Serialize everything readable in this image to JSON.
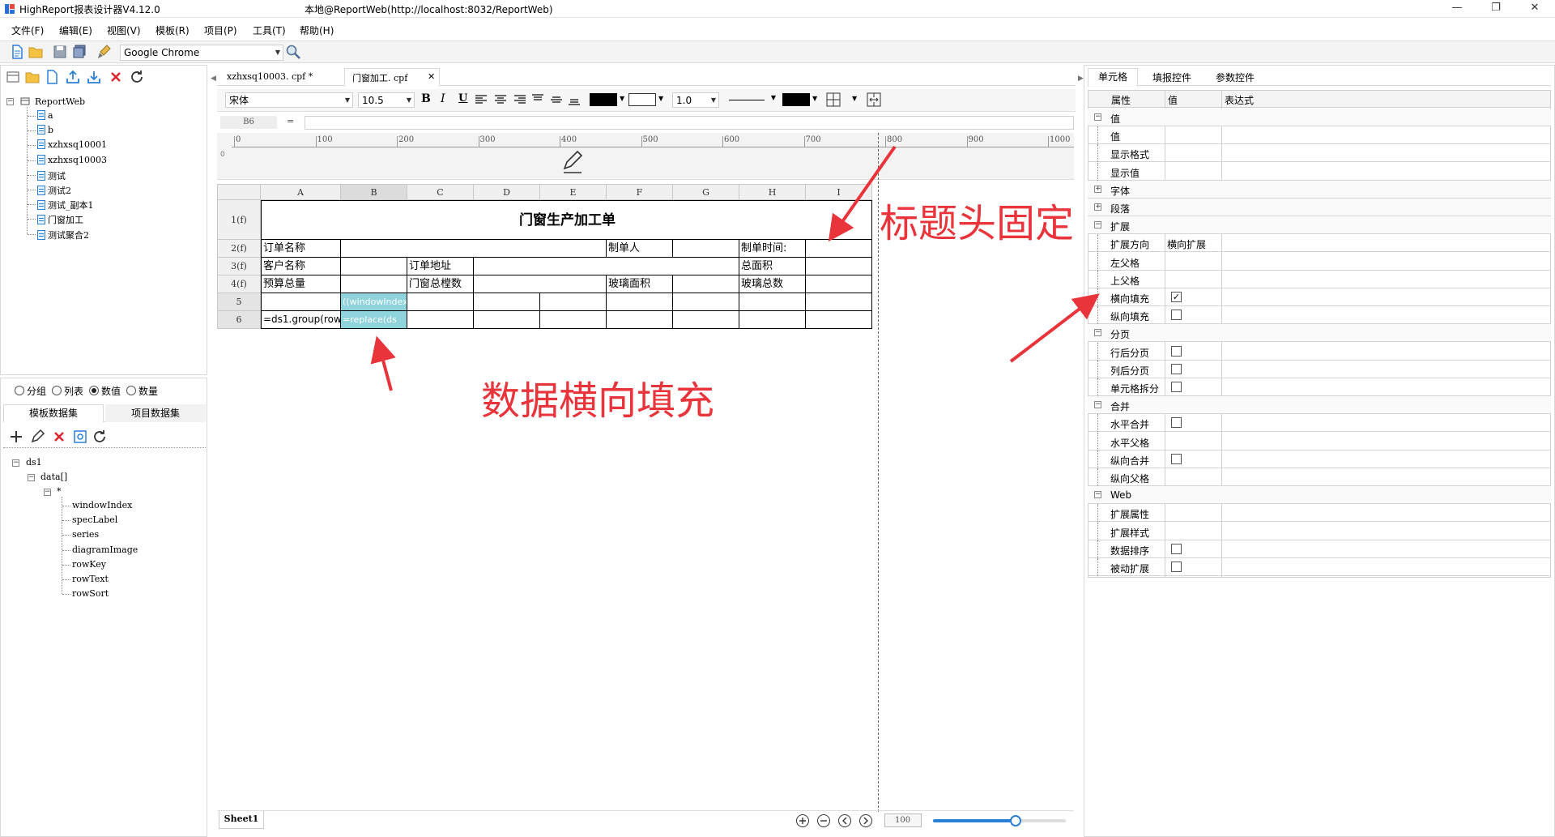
{
  "window": {
    "app_title": "HighReport报表设计器V4.12.0",
    "context_title": "本地@ReportWeb(http://localhost:8032/ReportWeb)",
    "minimize": "—",
    "maximize": "❐",
    "close": "✕"
  },
  "menu": [
    "文件(F)",
    "编辑(E)",
    "视图(V)",
    "模板(R)",
    "项目(P)",
    "工具(T)",
    "帮助(H)"
  ],
  "toolbar": {
    "browser": "Google Chrome"
  },
  "tree": {
    "root": "ReportWeb",
    "items": [
      "a",
      "b",
      "xzhxsq10001",
      "xzhxsq10003",
      "测试",
      "测试2",
      "测试_副本1",
      "门窗加工",
      "测试聚合2"
    ]
  },
  "dataset_panel": {
    "radios": [
      {
        "label": "分组",
        "checked": false
      },
      {
        "label": "列表",
        "checked": false
      },
      {
        "label": "数值",
        "checked": true
      },
      {
        "label": "数量",
        "checked": false
      }
    ],
    "tabs": [
      "模板数据集",
      "项目数据集"
    ],
    "root": "ds1",
    "node": "data[]",
    "star": "*",
    "fields": [
      "windowIndex",
      "specLabel",
      "series",
      "diagramImage",
      "rowKey",
      "rowText",
      "rowSort"
    ]
  },
  "editor_tabs": [
    {
      "label": "xzhxsq10003. cpf *",
      "active": false
    },
    {
      "label": "门窗加工. cpf",
      "active": true,
      "close": "✕"
    }
  ],
  "format": {
    "font": "宋体",
    "size": "10.5",
    "bold": "B",
    "italic": "I",
    "underline": "U",
    "line_width": "1.0",
    "cell_ref": "B6",
    "eq": "="
  },
  "ruler": [
    "0",
    "100",
    "200",
    "300",
    "400",
    "500",
    "600",
    "700",
    "800",
    "900",
    "1000"
  ],
  "columns": [
    "A",
    "B",
    "C",
    "D",
    "E",
    "F",
    "G",
    "H",
    "I"
  ],
  "rows": [
    "1(f)",
    "2(f)",
    "3(f)",
    "4(f)",
    "5",
    "6"
  ],
  "sheet": {
    "title": "门窗生产加工单",
    "r2": {
      "a": "订单名称",
      "f": "制单人",
      "h": "制单时间:"
    },
    "r3": {
      "a": "客户名称",
      "c": "订单地址",
      "h": "总面积"
    },
    "r4": {
      "a": "预算总量",
      "c": "门窗总樘数",
      "f": "玻璃面积",
      "h": "玻璃总数"
    },
    "b5": "((windowIndex",
    "a6": "=ds1.group(row",
    "b6": "=replace(ds"
  },
  "bottom": {
    "sheet_tab": "Sheet1",
    "zoom": "100",
    "zoom_level": 0.62
  },
  "right_tabs": [
    "单元格",
    "填报控件",
    "参数控件"
  ],
  "prop_header": [
    "属性",
    "值",
    "表达式"
  ],
  "props": [
    {
      "type": "group",
      "label": "值",
      "expanded": true
    },
    {
      "type": "item",
      "label": "值"
    },
    {
      "type": "item",
      "label": "显示格式"
    },
    {
      "type": "item",
      "label": "显示值"
    },
    {
      "type": "group",
      "label": "字体",
      "expanded": false
    },
    {
      "type": "group",
      "label": "段落",
      "expanded": false
    },
    {
      "type": "group",
      "label": "扩展",
      "expanded": true
    },
    {
      "type": "item",
      "label": "扩展方向",
      "value": "横向扩展"
    },
    {
      "type": "item",
      "label": "左父格"
    },
    {
      "type": "item",
      "label": "上父格"
    },
    {
      "type": "item",
      "label": "横向填充",
      "check": true
    },
    {
      "type": "item",
      "label": "纵向填充",
      "check": false
    },
    {
      "type": "group",
      "label": "分页",
      "expanded": true
    },
    {
      "type": "item",
      "label": "行后分页",
      "check": false
    },
    {
      "type": "item",
      "label": "列后分页",
      "check": false
    },
    {
      "type": "item",
      "label": "单元格拆分",
      "check": false
    },
    {
      "type": "group",
      "label": "合并",
      "expanded": true
    },
    {
      "type": "item",
      "label": "水平合并",
      "check": false
    },
    {
      "type": "item",
      "label": "水平父格"
    },
    {
      "type": "item",
      "label": "纵向合并",
      "check": false
    },
    {
      "type": "item",
      "label": "纵向父格"
    },
    {
      "type": "group",
      "label": "Web",
      "expanded": true
    },
    {
      "type": "item",
      "label": "扩展属性"
    },
    {
      "type": "item",
      "label": "扩展样式"
    },
    {
      "type": "item",
      "label": "数据排序",
      "check": false
    },
    {
      "type": "item",
      "label": "被动扩展",
      "check": false
    }
  ],
  "annotations": {
    "header_fixed": "标题头固定",
    "horizontal_fill": "数据横向填充"
  },
  "colors": {
    "annotation": "#e8343a",
    "selection": "#8fd3dd",
    "accent": "#2a7fd6"
  }
}
